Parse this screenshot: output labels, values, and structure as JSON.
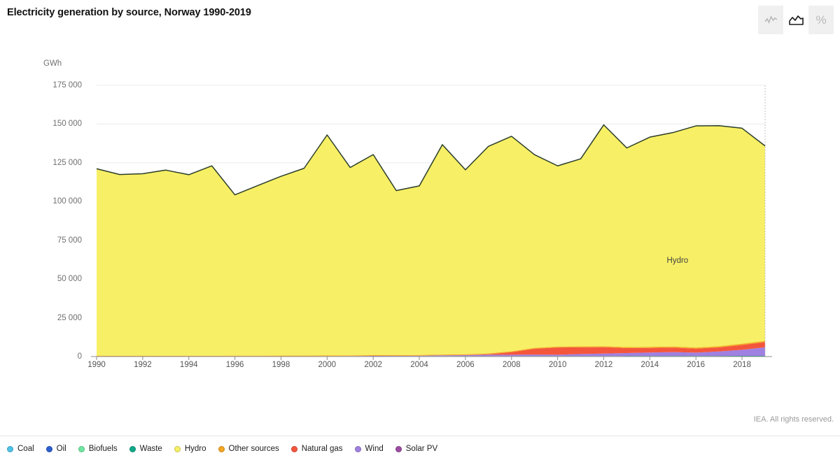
{
  "header": {
    "title": "Electricity generation by source, Norway 1990-2019",
    "toolbar": {
      "buttons": [
        {
          "name": "line-chart",
          "label": "Line chart",
          "icon": "line-chart-icon",
          "active": false
        },
        {
          "name": "area-chart",
          "label": "Area chart",
          "icon": "area-chart-icon",
          "active": true
        },
        {
          "name": "percent-chart",
          "label": "Percent stacked",
          "icon": "percent-icon",
          "glyph": "%",
          "active": false
        }
      ]
    }
  },
  "footer": {
    "credit": "IEA. All rights reserved."
  },
  "legend": {
    "items": [
      {
        "label": "Coal",
        "color": "#4fc3e8"
      },
      {
        "label": "Oil",
        "color": "#2e5fd0"
      },
      {
        "label": "Biofuels",
        "color": "#6ee7a0"
      },
      {
        "label": "Waste",
        "color": "#0fa98a"
      },
      {
        "label": "Hydro",
        "color": "#f7ef65"
      },
      {
        "label": "Other sources",
        "color": "#f5a623"
      },
      {
        "label": "Natural gas",
        "color": "#f4563c"
      },
      {
        "label": "Wind",
        "color": "#a080e0"
      },
      {
        "label": "Solar PV",
        "color": "#9c4ca0"
      }
    ]
  },
  "chart_data": {
    "type": "area",
    "stacked": true,
    "title": "Electricity generation by source, Norway 1990-2019",
    "xlabel": "",
    "ylabel": "GWh",
    "ylim": [
      0,
      175000
    ],
    "xlim": [
      1990,
      2019
    ],
    "grid": true,
    "legend_position": "bottom",
    "y_ticks": [
      0,
      25000,
      50000,
      75000,
      100000,
      125000,
      150000,
      175000
    ],
    "y_tick_labels": [
      "0",
      "25 000",
      "50 000",
      "75 000",
      "100 000",
      "125 000",
      "150 000",
      "175 000"
    ],
    "x_ticks": [
      1990,
      1992,
      1994,
      1996,
      1998,
      2000,
      2002,
      2004,
      2006,
      2008,
      2010,
      2012,
      2014,
      2016,
      2018
    ],
    "x_tick_labels": [
      "1990",
      "1992",
      "1994",
      "1996",
      "1998",
      "2000",
      "2002",
      "2004",
      "2006",
      "2008",
      "2010",
      "2012",
      "2014",
      "2016",
      "2018"
    ],
    "annotations": [
      {
        "text": "Hydro",
        "x": 2015.2,
        "y": 62000
      }
    ],
    "x": [
      1990,
      1991,
      1992,
      1993,
      1994,
      1995,
      1996,
      1997,
      1998,
      1999,
      2000,
      2001,
      2002,
      2003,
      2004,
      2005,
      2006,
      2007,
      2008,
      2009,
      2010,
      2011,
      2012,
      2013,
      2014,
      2015,
      2016,
      2017,
      2018,
      2019
    ],
    "series": [
      {
        "name": "Wind",
        "color": "#a080e0",
        "values": [
          0,
          0,
          0,
          0,
          0,
          0,
          0,
          5,
          10,
          20,
          30,
          80,
          180,
          220,
          260,
          500,
          640,
          880,
          900,
          980,
          870,
          1290,
          1570,
          1890,
          2220,
          2510,
          2130,
          2850,
          3870,
          5500
        ]
      },
      {
        "name": "Natural gas",
        "color": "#f4563c",
        "values": [
          0,
          0,
          0,
          0,
          0,
          0,
          0,
          0,
          0,
          0,
          0,
          0,
          0,
          0,
          0,
          0,
          0,
          300,
          1600,
          3700,
          4600,
          4280,
          4090,
          3140,
          2950,
          2860,
          2540,
          2600,
          3200,
          3300
        ]
      },
      {
        "name": "Other sources",
        "color": "#f5a623",
        "values": [
          300,
          300,
          300,
          320,
          330,
          340,
          350,
          360,
          380,
          400,
          420,
          440,
          460,
          480,
          500,
          520,
          540,
          560,
          580,
          600,
          620,
          640,
          660,
          680,
          700,
          720,
          740,
          760,
          780,
          800
        ]
      },
      {
        "name": "Waste",
        "color": "#0fa98a",
        "values": [
          60,
          65,
          70,
          75,
          80,
          85,
          90,
          95,
          100,
          110,
          120,
          130,
          140,
          150,
          160,
          170,
          180,
          190,
          200,
          210,
          220,
          230,
          240,
          250,
          260,
          270,
          280,
          290,
          300,
          310
        ]
      },
      {
        "name": "Biofuels",
        "color": "#6ee7a0",
        "values": [
          40,
          40,
          42,
          45,
          47,
          50,
          52,
          55,
          58,
          60,
          62,
          65,
          68,
          70,
          72,
          75,
          78,
          80,
          82,
          85,
          88,
          90,
          92,
          95,
          98,
          100,
          102,
          105,
          108,
          110
        ]
      },
      {
        "name": "Oil",
        "color": "#2e5fd0",
        "values": [
          30,
          30,
          30,
          30,
          30,
          30,
          30,
          30,
          30,
          28,
          26,
          24,
          22,
          20,
          20,
          20,
          20,
          18,
          18,
          16,
          16,
          15,
          15,
          14,
          14,
          13,
          13,
          12,
          12,
          12
        ]
      },
      {
        "name": "Coal",
        "color": "#4fc3e8",
        "values": [
          20,
          20,
          20,
          20,
          20,
          20,
          20,
          20,
          20,
          18,
          18,
          16,
          16,
          14,
          14,
          12,
          12,
          10,
          10,
          10,
          10,
          8,
          8,
          8,
          8,
          6,
          6,
          6,
          6,
          6
        ]
      },
      {
        "name": "Solar PV",
        "color": "#9c4ca0",
        "values": [
          0,
          0,
          0,
          0,
          0,
          0,
          0,
          0,
          0,
          0,
          0,
          0,
          0,
          0,
          0,
          0,
          0,
          0,
          0,
          0,
          0,
          0,
          0,
          0,
          0,
          0,
          5,
          10,
          20,
          40
        ]
      },
      {
        "name": "Hydro",
        "color": "#f7ef65",
        "values": [
          120700,
          117000,
          117500,
          119800,
          116800,
          122500,
          103800,
          109800,
          115700,
          120800,
          142300,
          121200,
          129400,
          106100,
          109100,
          135400,
          119000,
          133600,
          138700,
          124600,
          116600,
          121000,
          142800,
          128500,
          135300,
          138000,
          143000,
          142300,
          139000,
          125800
        ]
      }
    ],
    "stack_order": [
      "Hydro",
      "Other sources",
      "Natural gas",
      "Wind",
      "Solar PV",
      "Waste",
      "Biofuels",
      "Oil",
      "Coal"
    ]
  }
}
